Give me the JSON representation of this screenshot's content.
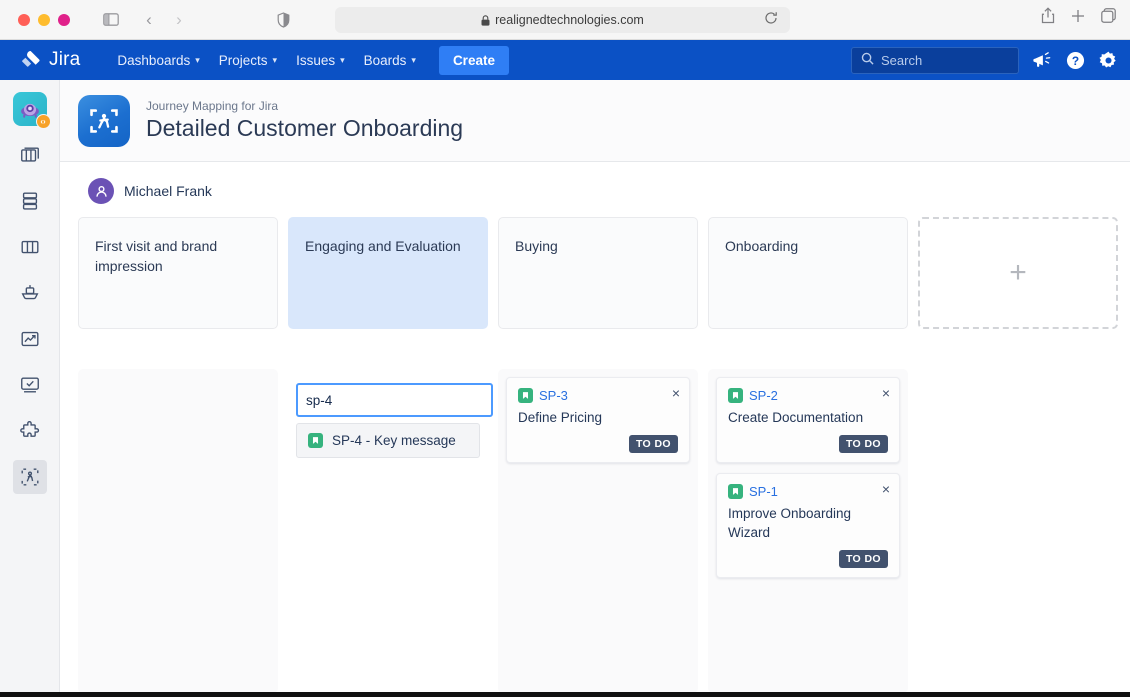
{
  "browser": {
    "url": "realignedtechnologies.com",
    "icons": {
      "sidebar": "sidebar-toggle-icon",
      "back": "back-arrow-icon",
      "forward": "forward-arrow-icon",
      "shield": "shield-icon",
      "lock": "lock-icon",
      "reload": "reload-icon",
      "share": "share-icon",
      "new_tab": "plus-icon",
      "tabs": "tab-overview-icon"
    },
    "back_glyph": "‹",
    "forward_glyph": "›",
    "reload_glyph": "↻",
    "plus_glyph": "+"
  },
  "jira_nav": {
    "logo_text": "Jira",
    "items": [
      {
        "label": "Dashboards",
        "has_caret": true
      },
      {
        "label": "Projects",
        "has_caret": true
      },
      {
        "label": "Issues",
        "has_caret": true
      },
      {
        "label": "Boards",
        "has_caret": true
      }
    ],
    "create_label": "Create",
    "search_placeholder": "Search",
    "caret_glyph": "▾",
    "icons": {
      "search": "search-icon",
      "announce": "megaphone-icon",
      "help": "help-icon",
      "settings": "gear-icon"
    },
    "colors": {
      "nav_bg": "#0b51c5",
      "create_bg": "#2f7ef5",
      "search_bg": "#0a3f9c"
    }
  },
  "app_rail": {
    "app_icon_name": "journey-mapping-app-icon",
    "app_badge_glyph": "‹›",
    "items": [
      {
        "name": "sidebar-item-boards",
        "icon": "columns-stacked-icon",
        "active": false
      },
      {
        "name": "sidebar-item-backlog",
        "icon": "database-icon",
        "active": false
      },
      {
        "name": "sidebar-item-columns",
        "icon": "columns-icon",
        "active": false
      },
      {
        "name": "sidebar-item-releases",
        "icon": "ship-icon",
        "active": false
      },
      {
        "name": "sidebar-item-reports",
        "icon": "chart-line-icon",
        "active": false
      },
      {
        "name": "sidebar-item-monitor",
        "icon": "monitor-check-icon",
        "active": false
      },
      {
        "name": "sidebar-item-apps",
        "icon": "puzzle-icon",
        "active": false
      },
      {
        "name": "sidebar-item-journey-mapping",
        "icon": "journey-frame-icon",
        "active": true
      }
    ]
  },
  "header": {
    "app_tile_icon": "journey-frame-icon",
    "subtitle": "Journey Mapping for Jira",
    "title": "Detailed Customer Onboarding"
  },
  "persona": {
    "avatar_icon": "person-icon",
    "name": "Michael Frank",
    "avatar_color": "#6b52b5"
  },
  "board": {
    "stages": [
      {
        "label": "First visit and brand impression",
        "selected": false
      },
      {
        "label": "Engaging and Evaluation",
        "selected": true
      },
      {
        "label": "Buying",
        "selected": false
      },
      {
        "label": "Onboarding",
        "selected": false
      }
    ],
    "add_stage": {
      "name": "add-stage-button",
      "glyph": "+"
    },
    "typeahead": {
      "value": "sp-4",
      "placeholder": "",
      "search_icon": "search-icon",
      "options": [
        {
          "icon": "story-icon",
          "label": "SP-4 - Key message"
        }
      ]
    },
    "columns": [
      {
        "name": "lane-body-first-visit",
        "cards": []
      },
      {
        "name": "lane-body-engaging",
        "cards": []
      },
      {
        "name": "lane-body-buying",
        "cards": [
          {
            "key": "SP-3",
            "summary": "Define Pricing",
            "status": "TO DO",
            "type_icon": "story-icon",
            "close_glyph": "×"
          }
        ]
      },
      {
        "name": "lane-body-onboarding",
        "cards": [
          {
            "key": "SP-2",
            "summary": "Create Documentation",
            "status": "TO DO",
            "type_icon": "story-icon",
            "close_glyph": "×"
          },
          {
            "key": "SP-1",
            "summary": "Improve Onboarding Wizard",
            "status": "TO DO",
            "type_icon": "story-icon",
            "close_glyph": "×"
          }
        ]
      }
    ],
    "colors": {
      "stage_selected_bg": "#d9e7fb",
      "status_badge_bg": "#42526e",
      "issue_key": "#2970e0",
      "story_icon": "#36b37e"
    }
  }
}
